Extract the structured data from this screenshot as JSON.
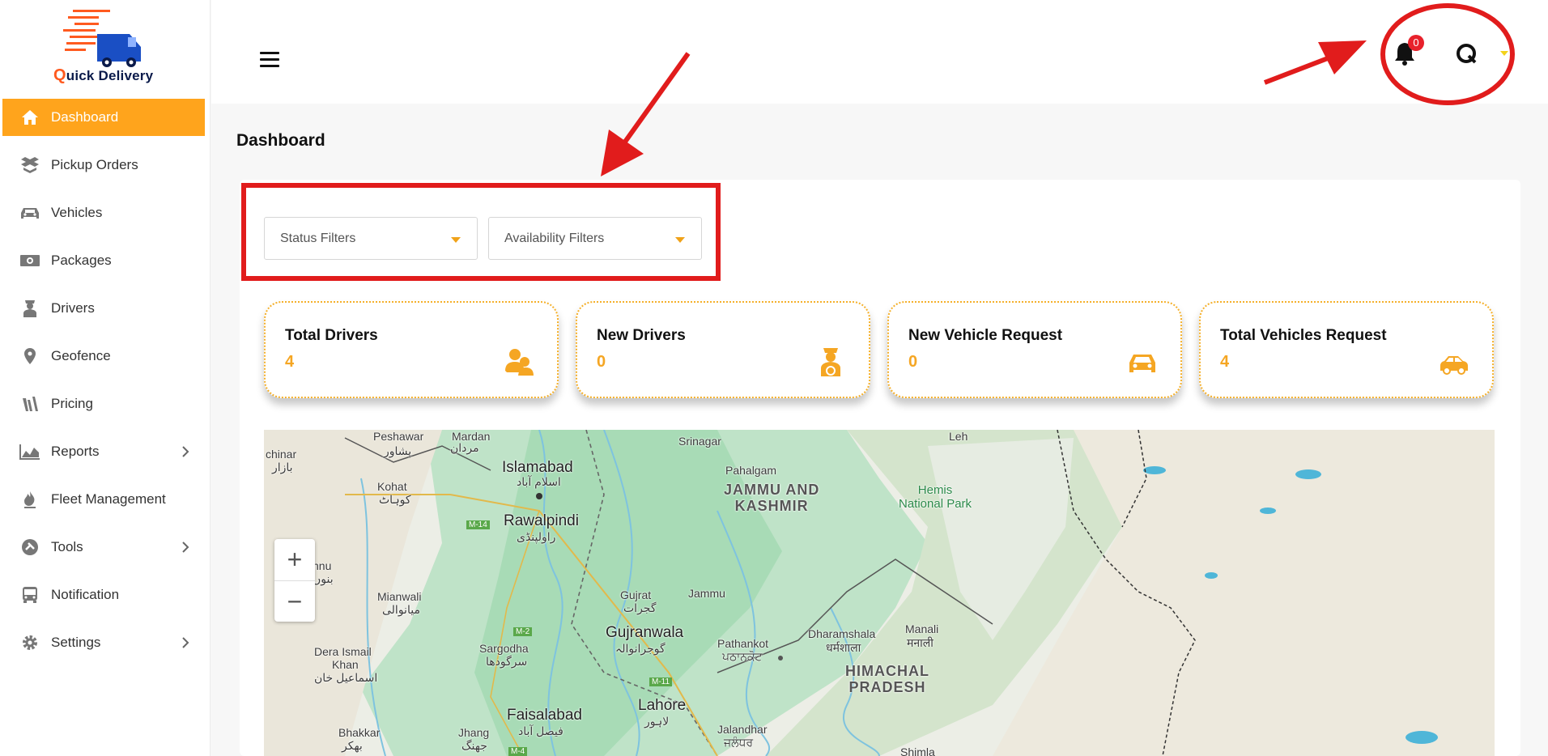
{
  "app": {
    "brand_first": "Q",
    "brand_rest": "uick Delivery"
  },
  "sidebar": {
    "items": [
      {
        "label": "Dashboard",
        "icon": "home-icon",
        "active": true
      },
      {
        "label": "Pickup Orders",
        "icon": "boxes-icon"
      },
      {
        "label": "Vehicles",
        "icon": "car-icon"
      },
      {
        "label": "Packages",
        "icon": "money-icon"
      },
      {
        "label": "Drivers",
        "icon": "driver-icon"
      },
      {
        "label": "Geofence",
        "icon": "map-pin-icon"
      },
      {
        "label": "Pricing",
        "icon": "pricing-icon"
      },
      {
        "label": "Reports",
        "icon": "area-chart-icon",
        "submenu": true
      },
      {
        "label": "Fleet Management",
        "icon": "flame-icon"
      },
      {
        "label": "Tools",
        "icon": "tools-icon",
        "submenu": true
      },
      {
        "label": "Notification",
        "icon": "bus-icon"
      },
      {
        "label": "Settings",
        "icon": "gear-icon",
        "submenu": true
      }
    ]
  },
  "header": {
    "notification_count": "0"
  },
  "page": {
    "title": "Dashboard"
  },
  "filters": {
    "status_placeholder": "Status Filters",
    "availability_placeholder": "Availability Filters"
  },
  "stats": [
    {
      "label": "Total Drivers",
      "value": "4",
      "icon": "users-icon"
    },
    {
      "label": "New Drivers",
      "value": "0",
      "icon": "driver-icon"
    },
    {
      "label": "New Vehicle Request",
      "value": "0",
      "icon": "car-icon"
    },
    {
      "label": "Total Vehicles Request",
      "value": "4",
      "icon": "car-side-icon"
    }
  ],
  "map": {
    "zoom_in": "+",
    "zoom_out": "−",
    "labels": {
      "peshawar": "Peshawar",
      "peshawar_ur": "پشاور",
      "mardan": "Mardan",
      "mardan_ur": "مردان",
      "islamabad": "Islamabad",
      "islamabad_ur": "اسلام آباد",
      "rawalpindi": "Rawalpindi",
      "rawalpindi_ur": "راولپنڈی",
      "kohat": "Kohat",
      "kohat_ur": "کوہاٹ",
      "chinar": "chinar",
      "chinar_ur": "بازار",
      "srinagar": "Srinagar",
      "pahalgam": "Pahalgam",
      "jk1": "JAMMU AND",
      "jk2": "KASHMIR",
      "hemis1": "Hemis",
      "hemis2": "National Park",
      "leh": "Leh",
      "mianwali": "Mianwali",
      "mianwali_ur": "میانوالی",
      "gujrat": "Gujrat",
      "gujrat_ur": "گجرات",
      "jammu": "Jammu",
      "gujranwala": "Gujranwala",
      "gujranwala_ur": "گوجرانوالہ",
      "sargodha": "Sargodha",
      "sargodha_ur": "سرگودھا",
      "pathankot": "Pathankot",
      "pathankot_pa": "ਪਠਾਨਕੋਟ",
      "dharamshala": "Dharamshala",
      "dharamshala_hi": "धर्मशाला",
      "manali": "Manali",
      "manali_hi": "मनाली",
      "hp1": "HIMACHAL",
      "hp2": "PRADESH",
      "dik1": "Dera Ismail",
      "dik2": "Khan",
      "dik_ur": "اسماعیل خان",
      "faisalabad": "Faisalabad",
      "faisalabad_ur": "فیصل آباد",
      "lahore": "Lahore",
      "lahore_ur": "لاہور",
      "jalandhar": "Jalandhar",
      "jalandhar_pa": "ਜਲੰਧਰ",
      "bhakkar": "Bhakkar",
      "bhakkar_ur": "بھکر",
      "jhang": "Jhang",
      "jhang_ur": "جھنگ",
      "shimla": "Shimla",
      "nnu": "nnu",
      "nnu_ur": "بنوں",
      "m14": "M-14",
      "m2": "M-2",
      "m11": "M-11",
      "m4": "M-4"
    }
  }
}
